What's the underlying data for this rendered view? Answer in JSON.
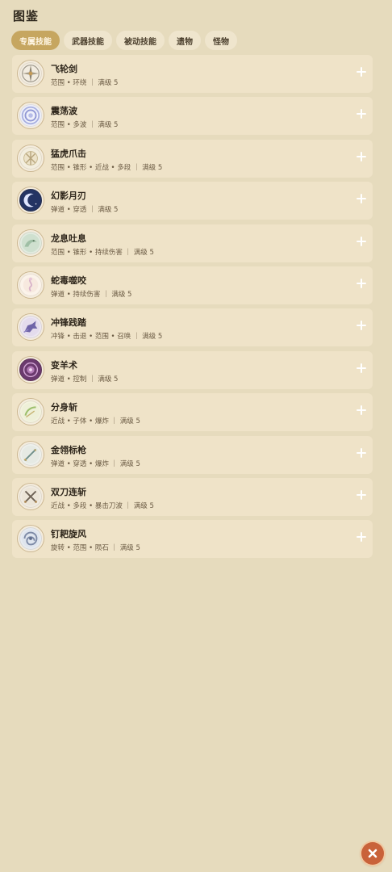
{
  "title": "图鉴",
  "tabs": [
    {
      "label": "专属技能",
      "active": true
    },
    {
      "label": "武器技能",
      "active": false
    },
    {
      "label": "被动技能",
      "active": false
    },
    {
      "label": "遗物",
      "active": false
    },
    {
      "label": "怪物",
      "active": false
    }
  ],
  "skills": [
    {
      "name": "飞轮剑",
      "meta": "范围 • 环绕 ｜ 满级 5",
      "icon": "flywheel-sword-icon"
    },
    {
      "name": "震荡波",
      "meta": "范围 • 多波 ｜ 满级 5",
      "icon": "shockwave-icon"
    },
    {
      "name": "猛虎爪击",
      "meta": "范围 • 锥形 • 近战 • 多段 ｜ 满级 5",
      "icon": "tiger-claw-icon"
    },
    {
      "name": "幻影月刃",
      "meta": "弹道 • 穿透 ｜ 满级 5",
      "icon": "moon-blade-icon"
    },
    {
      "name": "龙息吐息",
      "meta": "范围 • 锥形 • 持续伤害 ｜ 满级 5",
      "icon": "dragon-breath-icon"
    },
    {
      "name": "蛇毒噬咬",
      "meta": "弹道 • 持续伤害 ｜ 满级 5",
      "icon": "snake-bite-icon"
    },
    {
      "name": "冲锋践踏",
      "meta": "冲锋 • 击退 • 范围 • 召唤 ｜ 满级 5",
      "icon": "charge-trample-icon"
    },
    {
      "name": "变羊术",
      "meta": "弹道 • 控制 ｜ 满级 5",
      "icon": "polymorph-icon"
    },
    {
      "name": "分身斩",
      "meta": "近战 • 子体 • 爆炸 ｜ 满级 5",
      "icon": "clone-slash-icon"
    },
    {
      "name": "金翎标枪",
      "meta": "弹道 • 穿透 • 爆炸 ｜ 满级 5",
      "icon": "golden-javelin-icon"
    },
    {
      "name": "双刀连斩",
      "meta": "近战 • 多段 • 暴击刀波 ｜ 满级 5",
      "icon": "dual-blade-icon"
    },
    {
      "name": "钉耙旋风",
      "meta": "旋转 • 范围 • 陨石 ｜ 满级 5",
      "icon": "rake-whirlwind-icon"
    }
  ],
  "colors": {
    "background": "#e6dbbd",
    "card": "#efe3c8",
    "tab_active": "#c6a660",
    "close_button": "#c9623a"
  }
}
